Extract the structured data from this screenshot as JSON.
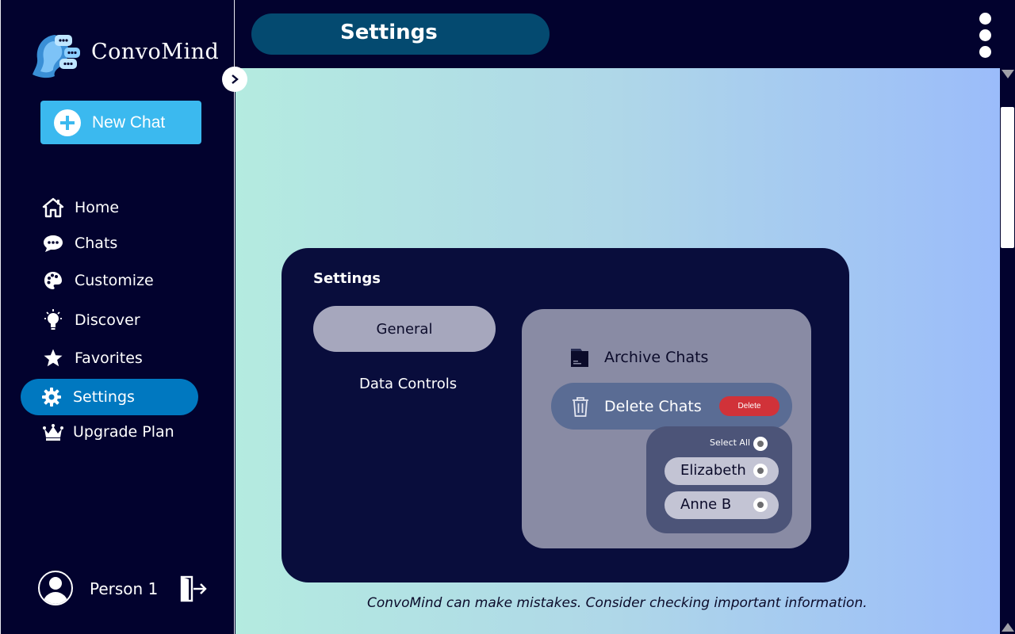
{
  "app": {
    "name": "ConvoMind"
  },
  "sidebar": {
    "new_chat_label": "New Chat",
    "items": [
      {
        "label": "Home",
        "icon": "home-icon"
      },
      {
        "label": "Chats",
        "icon": "chat-bubble-icon"
      },
      {
        "label": "Customize",
        "icon": "palette-icon"
      },
      {
        "label": "Discover",
        "icon": "lightbulb-icon"
      },
      {
        "label": "Favorites",
        "icon": "star-icon"
      },
      {
        "label": "Settings",
        "icon": "gear-icon",
        "active": true
      },
      {
        "label": "Upgrade Plan",
        "icon": "crown-icon"
      }
    ],
    "user": {
      "name": "Person 1"
    }
  },
  "header": {
    "title": "Settings"
  },
  "settings_modal": {
    "title": "Settings",
    "tabs": [
      {
        "label": "General",
        "active": true
      },
      {
        "label": "Data Controls",
        "active": false
      }
    ],
    "panel": {
      "archive_label": "Archive Chats",
      "delete_label": "Delete Chats",
      "delete_button": "Delete",
      "select_all_label": "Select All",
      "chats": [
        "Elizabeth",
        "Anne B"
      ]
    }
  },
  "footer": {
    "disclaimer": "ConvoMind can make mistakes. Consider checking important information."
  },
  "colors": {
    "background": "#02022e",
    "accent": "#3bb9ef",
    "active_nav": "#0078c0",
    "title_pill": "#044a70",
    "danger": "#d13239"
  }
}
